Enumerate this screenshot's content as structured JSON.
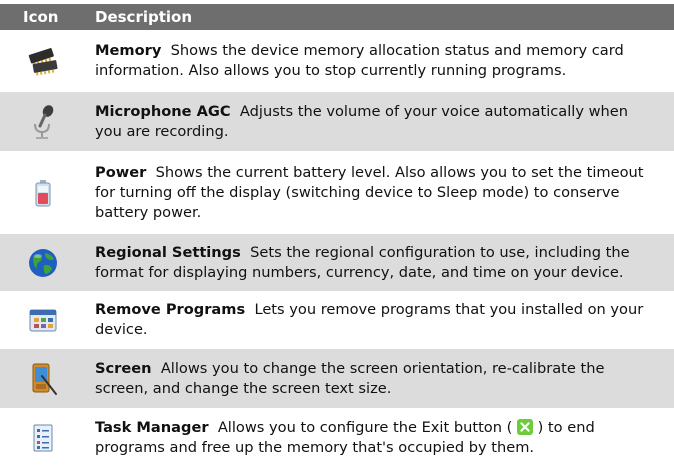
{
  "header": {
    "icon_col": "Icon",
    "desc_col": "Description"
  },
  "rows": [
    {
      "icon": "memory-chips-icon",
      "title": "Memory",
      "desc": "Shows the device memory allocation status and memory card information. Also allows you to stop currently running programs."
    },
    {
      "icon": "microphone-icon",
      "title": "Microphone AGC",
      "desc": "Adjusts the volume of your voice automatically when you are recording."
    },
    {
      "icon": "battery-icon",
      "title": "Power",
      "desc": "Shows the current battery level. Also allows you to set the timeout for turning off the display (switching device to Sleep mode) to conserve battery power."
    },
    {
      "icon": "globe-icon",
      "title": "Regional Settings",
      "desc": "Sets the regional configuration to use, including the format for displaying numbers, currency, date, and time on your device."
    },
    {
      "icon": "remove-programs-icon",
      "title": "Remove Programs",
      "desc": "Lets you remove programs that you installed on your device."
    },
    {
      "icon": "screen-stylus-icon",
      "title": "Screen",
      "desc": "Allows you to change the screen orientation, re-calibrate the screen, and change the screen text size."
    },
    {
      "icon": "task-manager-icon",
      "title": "Task Manager",
      "desc_before": "Allows you to configure the Exit button (",
      "desc_after": ") to end programs and free up the memory that's occupied by them."
    }
  ]
}
